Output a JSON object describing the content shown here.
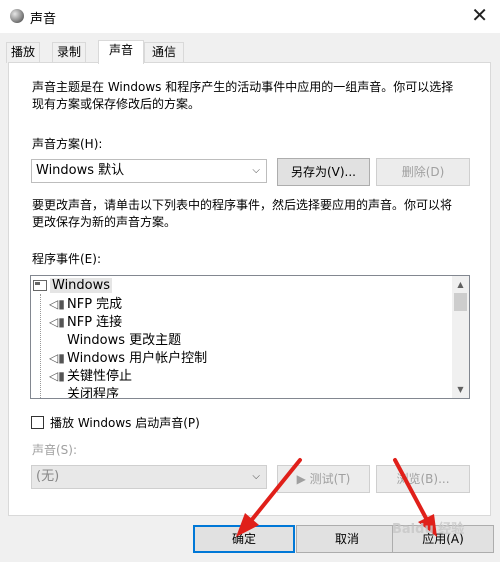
{
  "window": {
    "title": "声音"
  },
  "tabs": [
    {
      "label": "播放",
      "active": false
    },
    {
      "label": "录制",
      "active": false
    },
    {
      "label": "声音",
      "active": true
    },
    {
      "label": "通信",
      "active": false
    }
  ],
  "intro": {
    "line1": "声音主题是在 Windows 和程序产生的活动事件中应用的一组声音。你可以选择",
    "line2": "现有方案或保存修改后的方案。"
  },
  "scheme": {
    "label": "声音方案(H):",
    "selected": "Windows 默认",
    "save_as": "另存为(V)...",
    "delete": "删除(D)"
  },
  "change_hint": {
    "line1": "要更改声音，请单击以下列表中的程序事件，然后选择要应用的声音。你可以将",
    "line2": "更改保存为新的声音方案。"
  },
  "events": {
    "label": "程序事件(E):",
    "group": "Windows",
    "items": [
      {
        "label": "NFP 完成",
        "has_sound": true
      },
      {
        "label": "NFP 连接",
        "has_sound": true
      },
      {
        "label": "Windows 更改主题",
        "has_sound": false
      },
      {
        "label": "Windows 用户帐户控制",
        "has_sound": true
      },
      {
        "label": "关键性停止",
        "has_sound": true
      },
      {
        "label": "关闭程序",
        "has_sound": false
      }
    ]
  },
  "startup": {
    "label": "播放 Windows 启动声音(P)",
    "checked": false
  },
  "sounds": {
    "label": "声音(S):",
    "selected": "(无)",
    "test": "测试(T)",
    "browse": "浏览(B)..."
  },
  "footer": {
    "ok": "确定",
    "cancel": "取消",
    "apply": "应用(A)"
  },
  "watermark": "Baidu 经验",
  "colors": {
    "accent": "#0078d7",
    "annotation_arrow": "#e0201a"
  }
}
